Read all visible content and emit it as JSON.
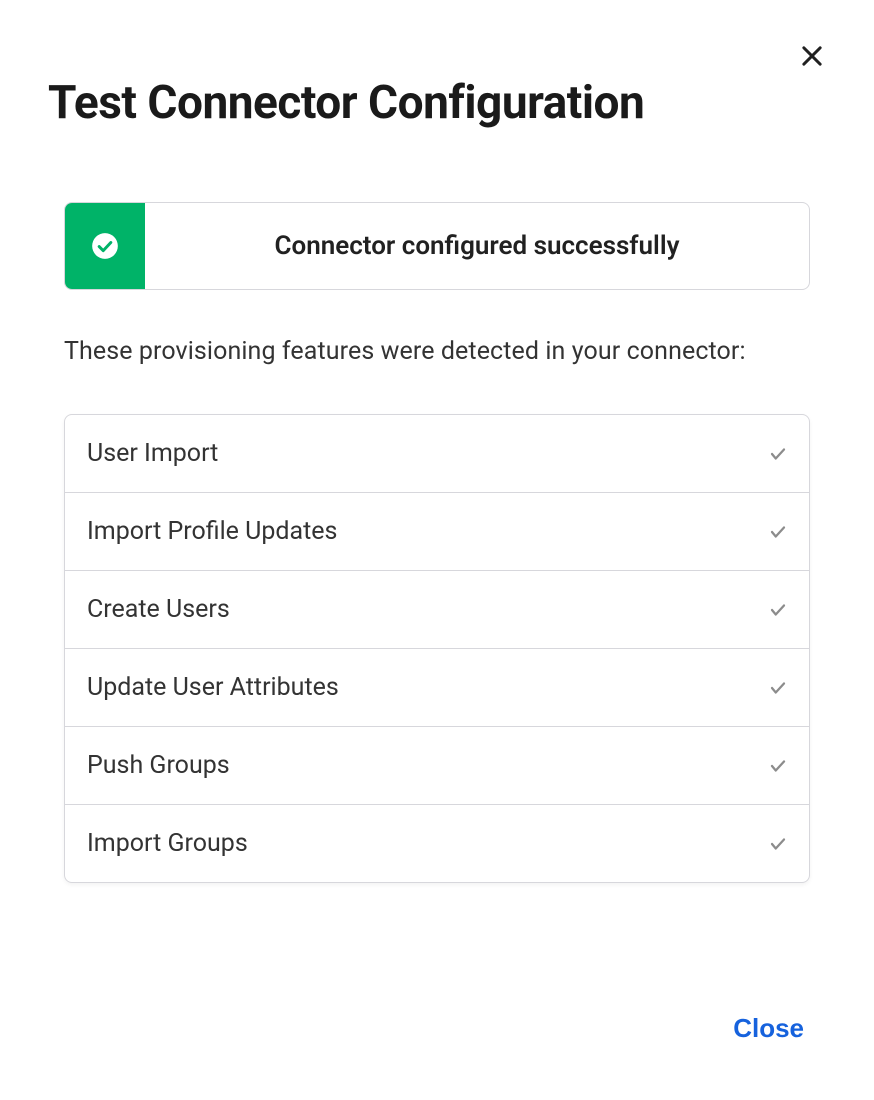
{
  "title": "Test Connector Configuration",
  "banner": {
    "message": "Connector configured successfully",
    "icon": "success-check-circle"
  },
  "subtitle": "These provisioning features were detected in your connector:",
  "features": [
    {
      "label": "User Import",
      "status": "check"
    },
    {
      "label": "Import Profile Updates",
      "status": "check"
    },
    {
      "label": "Create Users",
      "status": "check"
    },
    {
      "label": "Update User Attributes",
      "status": "check"
    },
    {
      "label": "Push Groups",
      "status": "check"
    },
    {
      "label": "Import Groups",
      "status": "check"
    }
  ],
  "actions": {
    "close_label": "Close"
  },
  "colors": {
    "success": "#00b368",
    "link": "#1662dd"
  }
}
